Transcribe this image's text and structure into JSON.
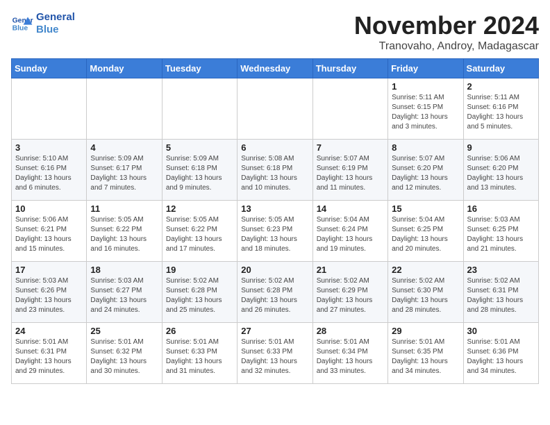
{
  "header": {
    "logo_line1": "General",
    "logo_line2": "Blue",
    "month": "November 2024",
    "location": "Tranovaho, Androy, Madagascar"
  },
  "weekdays": [
    "Sunday",
    "Monday",
    "Tuesday",
    "Wednesday",
    "Thursday",
    "Friday",
    "Saturday"
  ],
  "weeks": [
    [
      {
        "day": "",
        "info": ""
      },
      {
        "day": "",
        "info": ""
      },
      {
        "day": "",
        "info": ""
      },
      {
        "day": "",
        "info": ""
      },
      {
        "day": "",
        "info": ""
      },
      {
        "day": "1",
        "info": "Sunrise: 5:11 AM\nSunset: 6:15 PM\nDaylight: 13 hours\nand 3 minutes."
      },
      {
        "day": "2",
        "info": "Sunrise: 5:11 AM\nSunset: 6:16 PM\nDaylight: 13 hours\nand 5 minutes."
      }
    ],
    [
      {
        "day": "3",
        "info": "Sunrise: 5:10 AM\nSunset: 6:16 PM\nDaylight: 13 hours\nand 6 minutes."
      },
      {
        "day": "4",
        "info": "Sunrise: 5:09 AM\nSunset: 6:17 PM\nDaylight: 13 hours\nand 7 minutes."
      },
      {
        "day": "5",
        "info": "Sunrise: 5:09 AM\nSunset: 6:18 PM\nDaylight: 13 hours\nand 9 minutes."
      },
      {
        "day": "6",
        "info": "Sunrise: 5:08 AM\nSunset: 6:18 PM\nDaylight: 13 hours\nand 10 minutes."
      },
      {
        "day": "7",
        "info": "Sunrise: 5:07 AM\nSunset: 6:19 PM\nDaylight: 13 hours\nand 11 minutes."
      },
      {
        "day": "8",
        "info": "Sunrise: 5:07 AM\nSunset: 6:20 PM\nDaylight: 13 hours\nand 12 minutes."
      },
      {
        "day": "9",
        "info": "Sunrise: 5:06 AM\nSunset: 6:20 PM\nDaylight: 13 hours\nand 13 minutes."
      }
    ],
    [
      {
        "day": "10",
        "info": "Sunrise: 5:06 AM\nSunset: 6:21 PM\nDaylight: 13 hours\nand 15 minutes."
      },
      {
        "day": "11",
        "info": "Sunrise: 5:05 AM\nSunset: 6:22 PM\nDaylight: 13 hours\nand 16 minutes."
      },
      {
        "day": "12",
        "info": "Sunrise: 5:05 AM\nSunset: 6:22 PM\nDaylight: 13 hours\nand 17 minutes."
      },
      {
        "day": "13",
        "info": "Sunrise: 5:05 AM\nSunset: 6:23 PM\nDaylight: 13 hours\nand 18 minutes."
      },
      {
        "day": "14",
        "info": "Sunrise: 5:04 AM\nSunset: 6:24 PM\nDaylight: 13 hours\nand 19 minutes."
      },
      {
        "day": "15",
        "info": "Sunrise: 5:04 AM\nSunset: 6:25 PM\nDaylight: 13 hours\nand 20 minutes."
      },
      {
        "day": "16",
        "info": "Sunrise: 5:03 AM\nSunset: 6:25 PM\nDaylight: 13 hours\nand 21 minutes."
      }
    ],
    [
      {
        "day": "17",
        "info": "Sunrise: 5:03 AM\nSunset: 6:26 PM\nDaylight: 13 hours\nand 23 minutes."
      },
      {
        "day": "18",
        "info": "Sunrise: 5:03 AM\nSunset: 6:27 PM\nDaylight: 13 hours\nand 24 minutes."
      },
      {
        "day": "19",
        "info": "Sunrise: 5:02 AM\nSunset: 6:28 PM\nDaylight: 13 hours\nand 25 minutes."
      },
      {
        "day": "20",
        "info": "Sunrise: 5:02 AM\nSunset: 6:28 PM\nDaylight: 13 hours\nand 26 minutes."
      },
      {
        "day": "21",
        "info": "Sunrise: 5:02 AM\nSunset: 6:29 PM\nDaylight: 13 hours\nand 27 minutes."
      },
      {
        "day": "22",
        "info": "Sunrise: 5:02 AM\nSunset: 6:30 PM\nDaylight: 13 hours\nand 28 minutes."
      },
      {
        "day": "23",
        "info": "Sunrise: 5:02 AM\nSunset: 6:31 PM\nDaylight: 13 hours\nand 28 minutes."
      }
    ],
    [
      {
        "day": "24",
        "info": "Sunrise: 5:01 AM\nSunset: 6:31 PM\nDaylight: 13 hours\nand 29 minutes."
      },
      {
        "day": "25",
        "info": "Sunrise: 5:01 AM\nSunset: 6:32 PM\nDaylight: 13 hours\nand 30 minutes."
      },
      {
        "day": "26",
        "info": "Sunrise: 5:01 AM\nSunset: 6:33 PM\nDaylight: 13 hours\nand 31 minutes."
      },
      {
        "day": "27",
        "info": "Sunrise: 5:01 AM\nSunset: 6:33 PM\nDaylight: 13 hours\nand 32 minutes."
      },
      {
        "day": "28",
        "info": "Sunrise: 5:01 AM\nSunset: 6:34 PM\nDaylight: 13 hours\nand 33 minutes."
      },
      {
        "day": "29",
        "info": "Sunrise: 5:01 AM\nSunset: 6:35 PM\nDaylight: 13 hours\nand 34 minutes."
      },
      {
        "day": "30",
        "info": "Sunrise: 5:01 AM\nSunset: 6:36 PM\nDaylight: 13 hours\nand 34 minutes."
      }
    ]
  ]
}
